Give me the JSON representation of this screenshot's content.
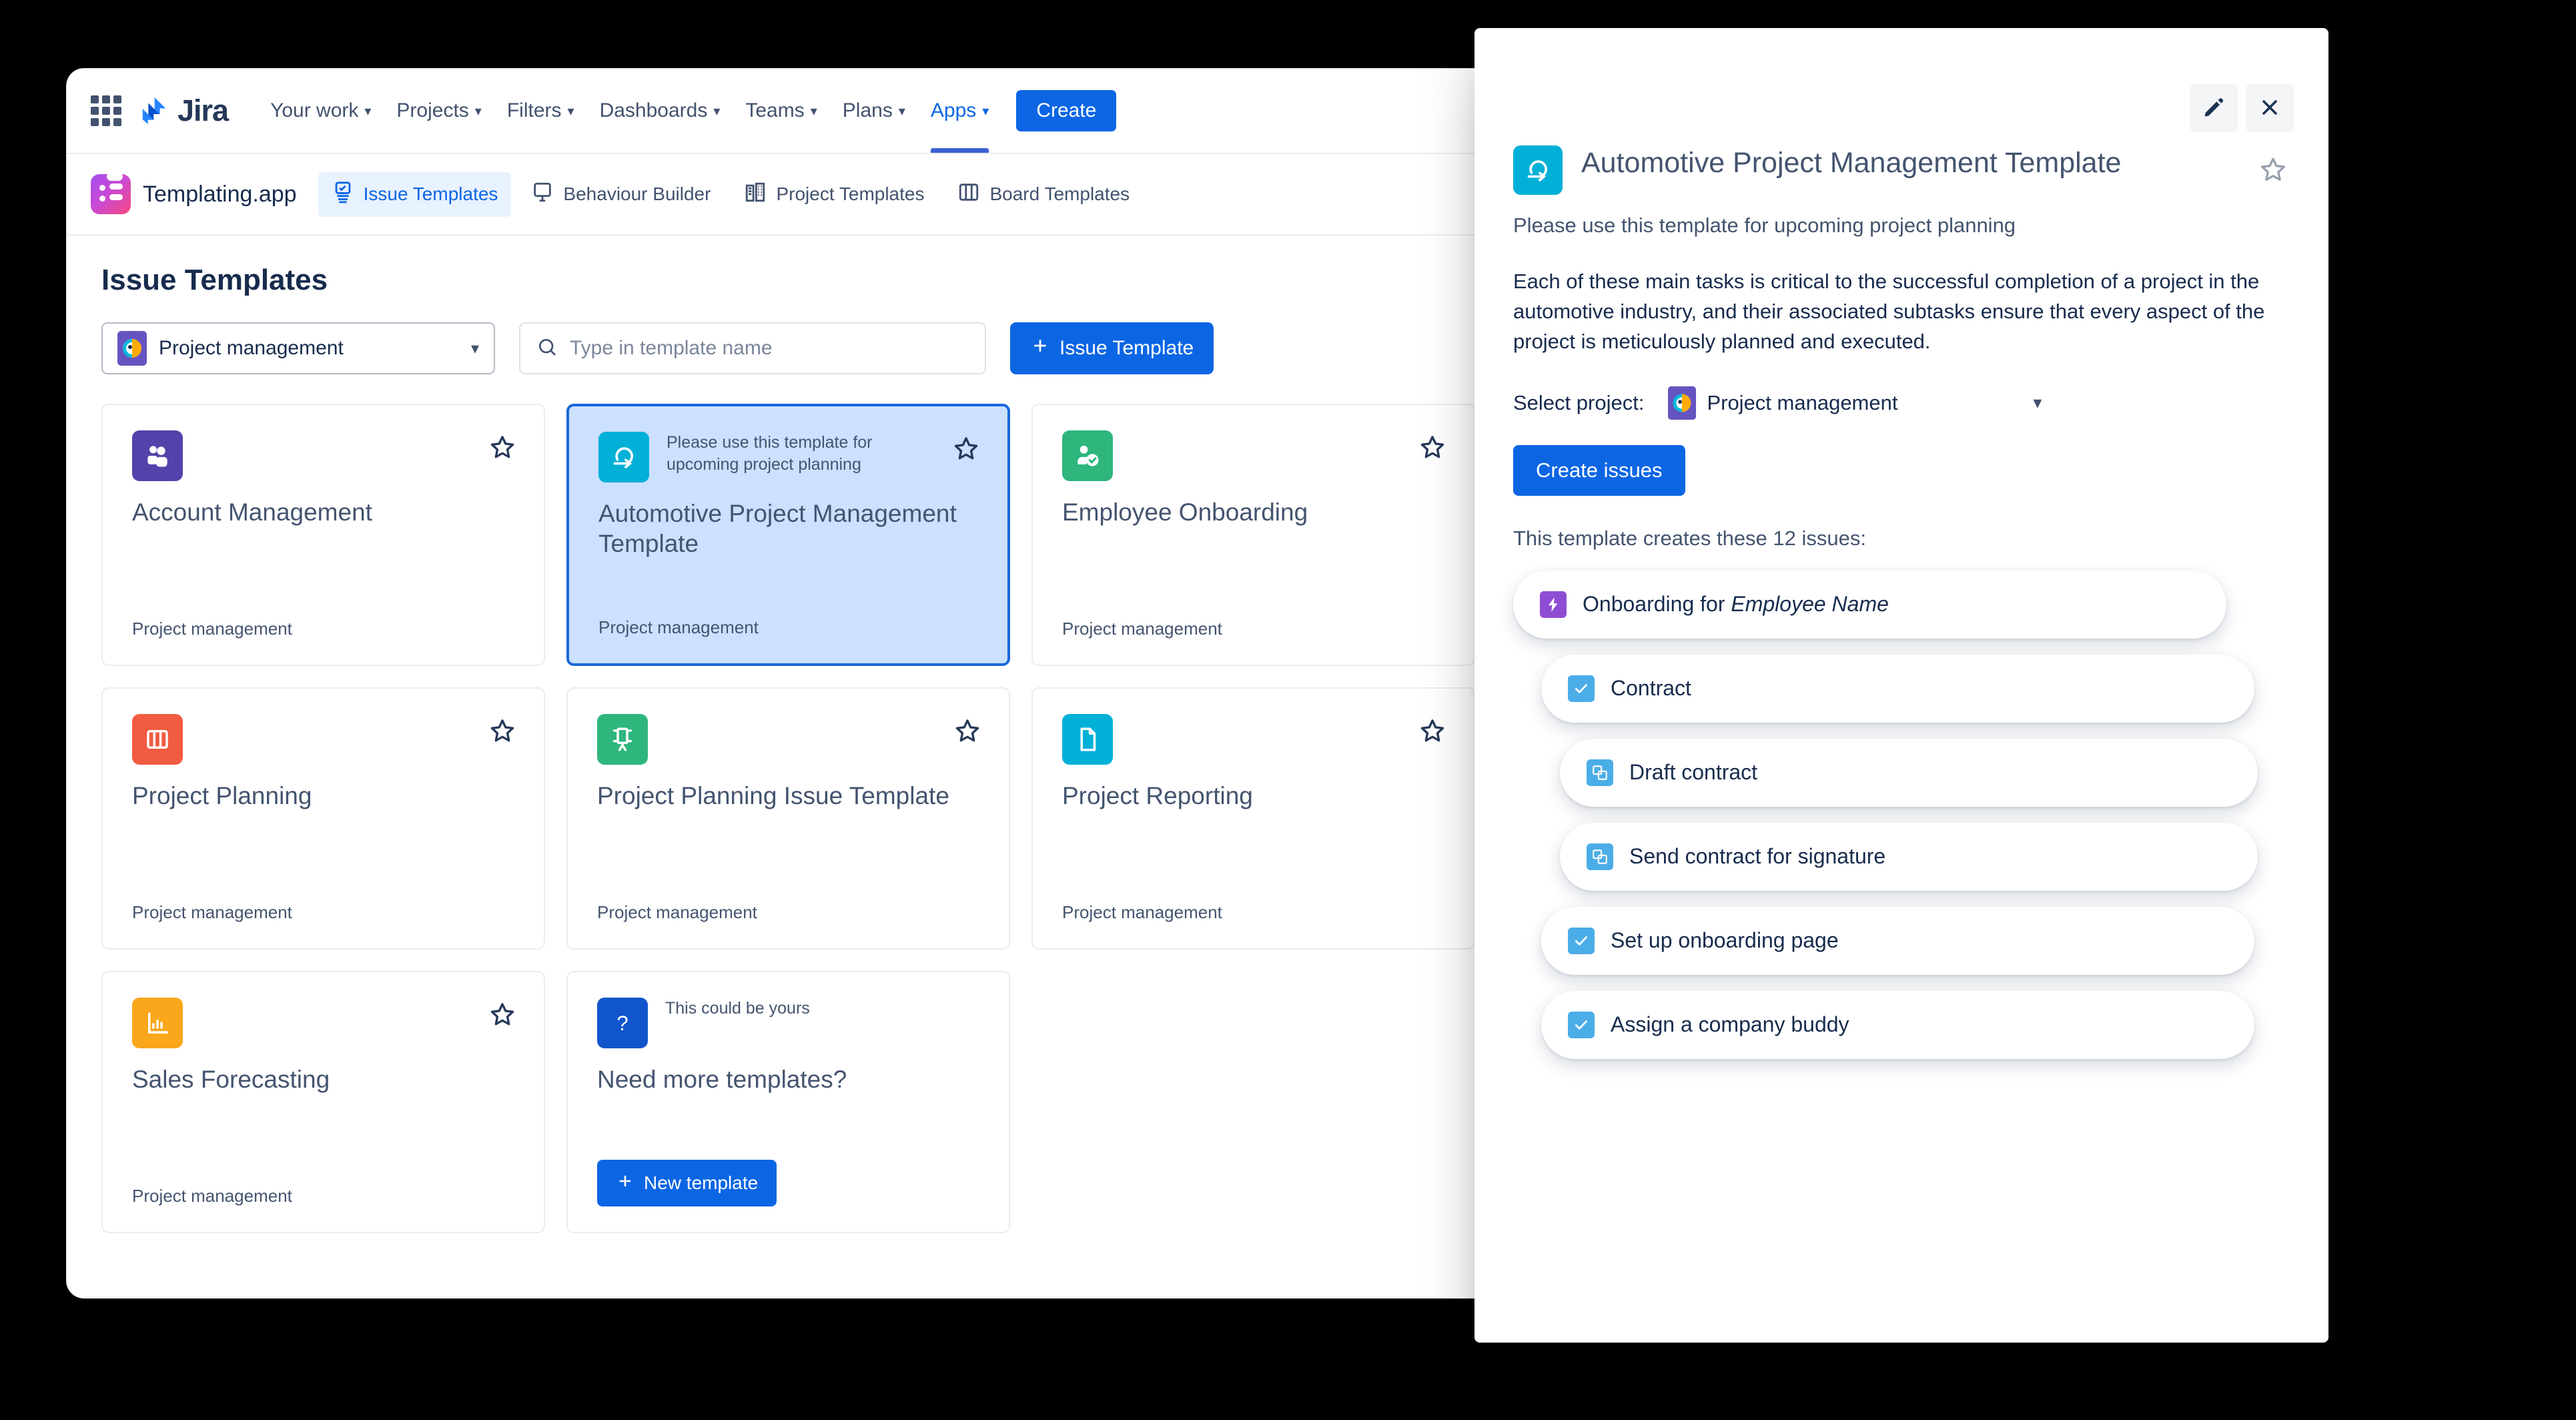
{
  "jira": {
    "brand": "Jira",
    "nav": [
      {
        "label": "Your work",
        "caret": true,
        "active": false
      },
      {
        "label": "Projects",
        "caret": true,
        "active": false
      },
      {
        "label": "Filters",
        "caret": true,
        "active": false
      },
      {
        "label": "Dashboards",
        "caret": true,
        "active": false
      },
      {
        "label": "Teams",
        "caret": true,
        "active": false
      },
      {
        "label": "Plans",
        "caret": true,
        "active": false
      },
      {
        "label": "Apps",
        "caret": true,
        "active": true
      }
    ],
    "create_label": "Create"
  },
  "appbar": {
    "brand_name": "Templating.app",
    "tabs": [
      {
        "label": "Issue Templates",
        "icon": "issue-templates-icon",
        "active": true
      },
      {
        "label": "Behaviour Builder",
        "icon": "behaviour-builder-icon",
        "active": false
      },
      {
        "label": "Project Templates",
        "icon": "project-templates-icon",
        "active": false
      },
      {
        "label": "Board Templates",
        "icon": "board-templates-icon",
        "active": false
      }
    ]
  },
  "page": {
    "title": "Issue Templates",
    "project_filter": {
      "value": "Project management",
      "caret": "chevron-down-icon"
    },
    "search": {
      "value": "",
      "placeholder": "Type in template name",
      "icon": "search-icon"
    },
    "add_button": {
      "label": "Issue Template",
      "icon": "plus-icon"
    }
  },
  "cards": [
    {
      "title": "Account Management",
      "note": "",
      "subtitle": "Project management",
      "icon": "people-icon",
      "icon_color": "#5243aa",
      "selected": false,
      "star": "star-outline-icon"
    },
    {
      "title": "Automotive Project Management Template",
      "note": "Please use this template for upcoming project planning",
      "subtitle": "Project management",
      "icon": "agile-loop-icon",
      "icon_color": "#00b0d7",
      "selected": true,
      "star": "star-outline-icon"
    },
    {
      "title": "Employee Onboarding",
      "note": "",
      "subtitle": "Project management",
      "icon": "person-check-icon",
      "icon_color": "#2eb67d",
      "selected": false,
      "star": "star-outline-icon"
    },
    {
      "title": "Project Planning",
      "note": "",
      "subtitle": "Project management",
      "icon": "board-columns-icon",
      "icon_color": "#f15b41",
      "selected": false,
      "star": "star-outline-icon"
    },
    {
      "title": "Project Planning Issue Template",
      "note": "",
      "subtitle": "Project management",
      "icon": "easel-icon",
      "icon_color": "#2eb67d",
      "selected": false,
      "star": "star-outline-icon"
    },
    {
      "title": "Project Reporting",
      "note": "",
      "subtitle": "Project management",
      "icon": "document-icon",
      "icon_color": "#00b0d7",
      "selected": false,
      "star": "star-outline-icon"
    },
    {
      "title": "Sales Forecasting",
      "note": "",
      "subtitle": "Project management",
      "icon": "bar-chart-icon",
      "icon_color": "#faa71b",
      "selected": false,
      "star": "star-outline-icon"
    }
  ],
  "promo_card": {
    "note": "This could be yours",
    "title": "Need more templates?",
    "button_label": "New template",
    "icon": "question-mark-icon",
    "icon_color": "#1155cc"
  },
  "panel": {
    "edit_icon": "pencil-icon",
    "close_icon": "close-icon",
    "star_icon": "star-outline-icon",
    "template_icon": "agile-loop-icon",
    "title": "Automotive Project Management Template",
    "note": "Please use this template for upcoming project planning",
    "description": "Each of these main tasks is critical to the successful completion of a project in the automotive industry, and their associated subtasks ensure that every aspect of the project is meticulously planned and executed.",
    "select_label": "Select project:",
    "selected_project": "Project management",
    "select_caret": "chevron-down-icon",
    "create_button": "Create issues",
    "issues_count_text": "This template creates these 12 issues:",
    "issues": [
      {
        "text": "Onboarding for ",
        "emphasis": "Employee Name",
        "level": 0,
        "type": "epic",
        "icon": "epic-bolt-icon"
      },
      {
        "text": "Contract",
        "emphasis": "",
        "level": 1,
        "type": "task",
        "icon": "task-check-icon"
      },
      {
        "text": "Draft contract",
        "emphasis": "",
        "level": 2,
        "type": "subtask",
        "icon": "subtask-icon"
      },
      {
        "text": "Send contract for signature",
        "emphasis": "",
        "level": 2,
        "type": "subtask",
        "icon": "subtask-icon"
      },
      {
        "text": "Set up onboarding page",
        "emphasis": "",
        "level": 1,
        "type": "task",
        "icon": "task-check-icon"
      },
      {
        "text": "Assign a company buddy",
        "emphasis": "",
        "level": 1,
        "type": "task",
        "icon": "task-check-icon"
      }
    ]
  },
  "colors": {
    "brand_blue": "#0c66e4",
    "selected_card_bg": "#cce0ff",
    "selected_card_border": "#1868db",
    "text_primary": "#172b4d",
    "text_muted": "#44546f",
    "epic_purple": "#8f4dd4",
    "task_blue": "#4bade8"
  }
}
